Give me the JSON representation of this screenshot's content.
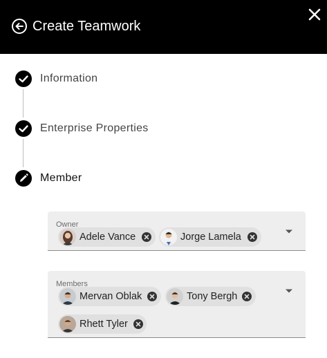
{
  "header": {
    "title": "Create Teamwork",
    "back_icon": "arrow-back-circle-icon",
    "close_icon": "close-icon"
  },
  "steps": [
    {
      "label": "Information",
      "state": "completed",
      "icon": "check-icon"
    },
    {
      "label": "Enterprise Properties",
      "state": "completed",
      "icon": "check-icon"
    },
    {
      "label": "Member",
      "state": "active",
      "icon": "pencil-icon"
    }
  ],
  "owner_field": {
    "label": "Owner",
    "chips": [
      {
        "name": "Adele Vance"
      },
      {
        "name": "Jorge Lamela"
      }
    ]
  },
  "members_field": {
    "label": "Members",
    "chips": [
      {
        "name": "Mervan Oblak"
      },
      {
        "name": "Tony Bergh"
      },
      {
        "name": "Rhett Tyler"
      }
    ]
  },
  "colors": {
    "header_bg": "#000000",
    "field_bg": "#eeeeee",
    "chip_bg": "#e0e0e0"
  }
}
